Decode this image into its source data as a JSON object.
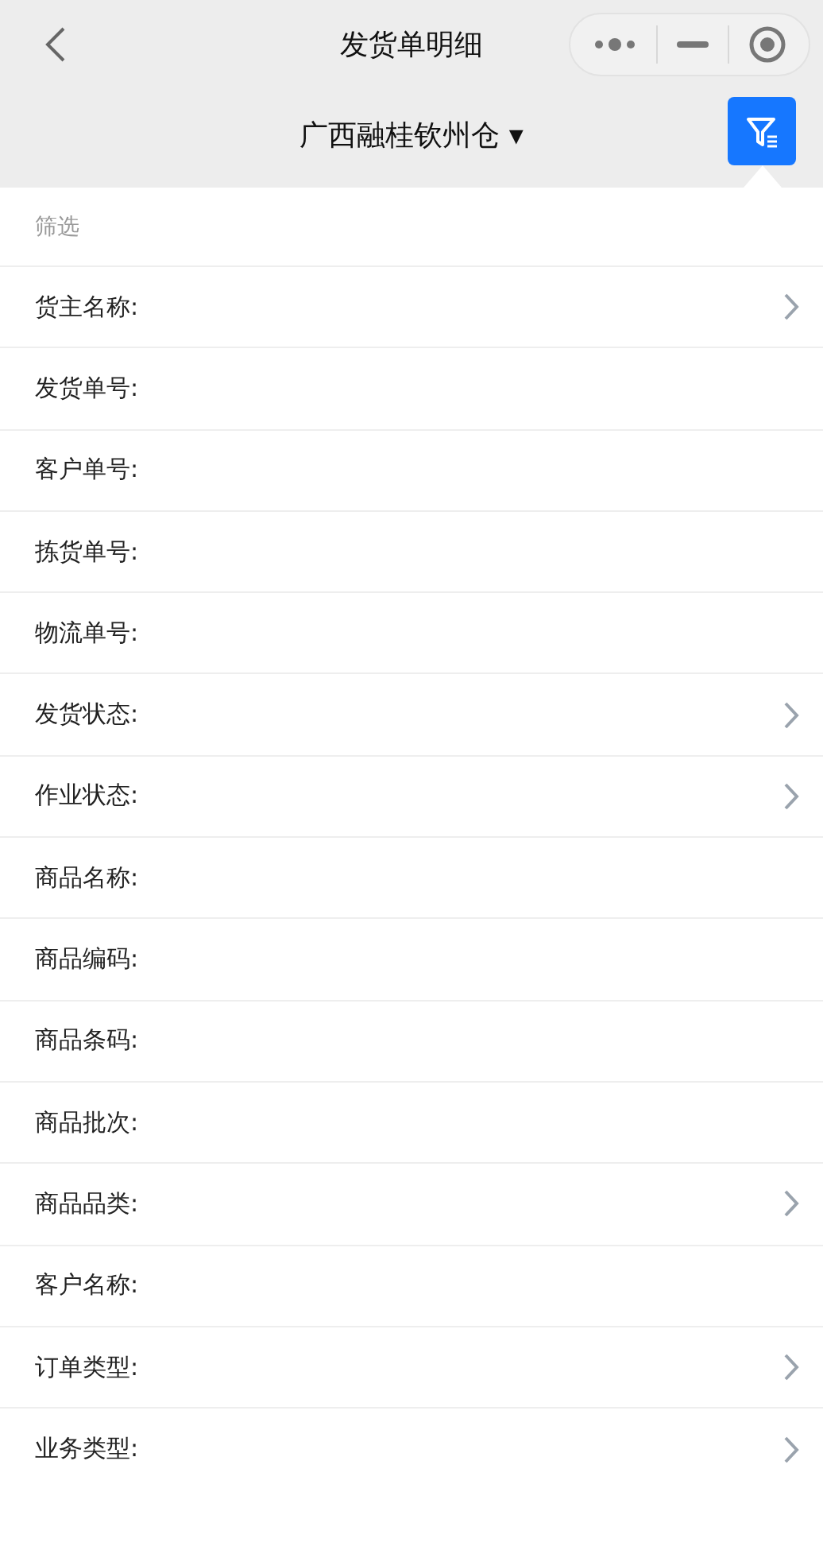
{
  "nav_bar": {
    "title": "发货单明细"
  },
  "warehouse_selector": {
    "label": "广西融桂钦州仓",
    "caret": "▾"
  },
  "filter_panel": {
    "heading": "筛选",
    "fields": [
      {
        "label": "货主名称:",
        "kind": "picker"
      },
      {
        "label": "发货单号:",
        "kind": "text"
      },
      {
        "label": "客户单号:",
        "kind": "text"
      },
      {
        "label": "拣货单号:",
        "kind": "text"
      },
      {
        "label": "物流单号:",
        "kind": "text"
      },
      {
        "label": "发货状态:",
        "kind": "picker"
      },
      {
        "label": "作业状态:",
        "kind": "picker"
      },
      {
        "label": "商品名称:",
        "kind": "text"
      },
      {
        "label": "商品编码:",
        "kind": "text"
      },
      {
        "label": "商品条码:",
        "kind": "text"
      },
      {
        "label": "商品批次:",
        "kind": "text"
      },
      {
        "label": "商品品类:",
        "kind": "picker"
      },
      {
        "label": "客户名称:",
        "kind": "text"
      },
      {
        "label": "订单类型:",
        "kind": "picker"
      },
      {
        "label": "业务类型:",
        "kind": "picker"
      }
    ]
  }
}
